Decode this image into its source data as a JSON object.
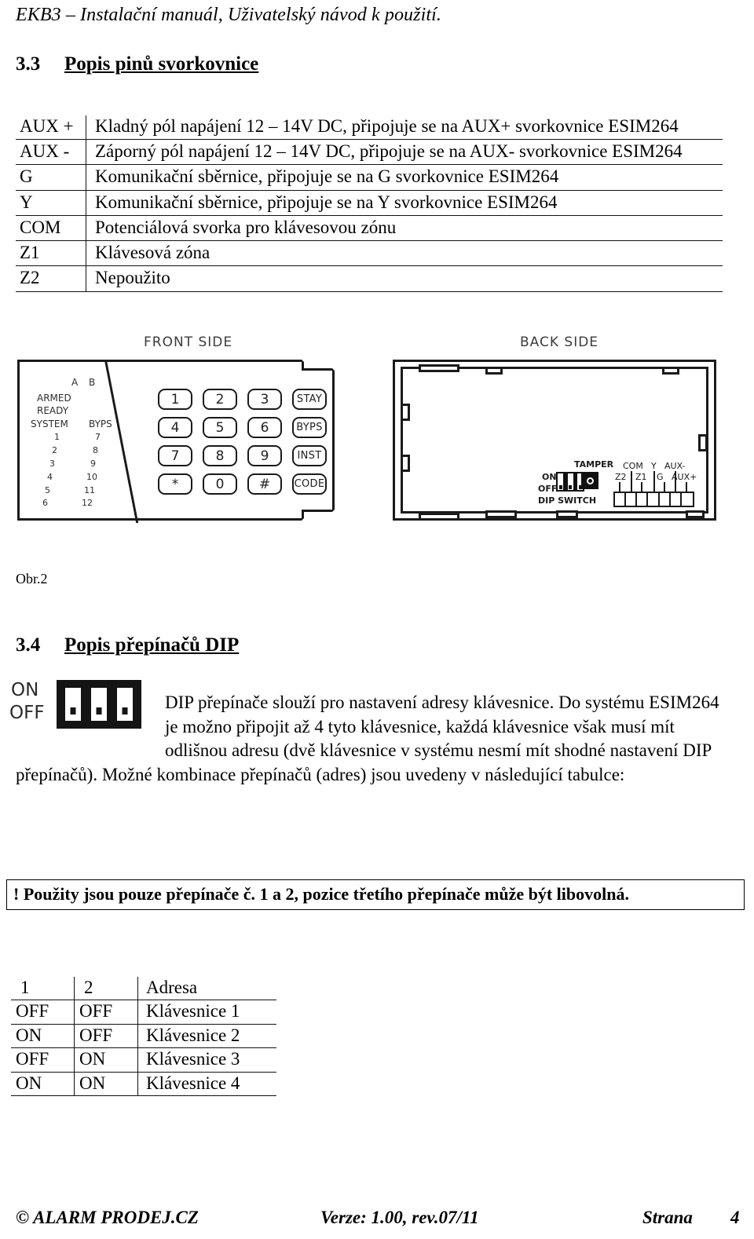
{
  "header": {
    "running_title": "EKB3 – Instalační manuál, Uživatelský návod k použití."
  },
  "sections": [
    {
      "number": "3.3",
      "title": "Popis pinů svorkovnice"
    },
    {
      "number": "3.4",
      "title": "Popis přepínačů DIP"
    }
  ],
  "pin_table": {
    "rows": [
      {
        "pin": "AUX +",
        "desc": "Kladný pól napájení 12 – 14V DC, připojuje se na AUX+ svorkovnice ESIM264"
      },
      {
        "pin": "AUX -",
        "desc": "Záporný pól napájení 12 – 14V DC, připojuje se na AUX- svorkovnice ESIM264"
      },
      {
        "pin": "G",
        "desc": "Komunikační sběrnice, připojuje se na G svorkovnice ESIM264"
      },
      {
        "pin": "Y",
        "desc": "Komunikační sběrnice, připojuje se na Y svorkovnice ESIM264"
      },
      {
        "pin": "COM",
        "desc": "Potenciálová svorka pro klávesovou zónu"
      },
      {
        "pin": "Z1",
        "desc": "Klávesová zóna"
      },
      {
        "pin": "Z2",
        "desc": "Nepoužito"
      }
    ]
  },
  "figure": {
    "caption": "Obr.2",
    "front": {
      "title": "FRONT SIDE",
      "col_headers": [
        "A",
        "B"
      ],
      "status_labels": [
        "ARMED",
        "READY",
        "SYSTEM"
      ],
      "zone_col_left": [
        "1",
        "2",
        "3",
        "4",
        "5",
        "6"
      ],
      "bypass_label": "BYPS",
      "zone_col_right": [
        "7",
        "8",
        "9",
        "10",
        "11",
        "12"
      ],
      "keys": [
        "1",
        "2",
        "3",
        "STAY",
        "4",
        "5",
        "6",
        "BYPS",
        "7",
        "8",
        "9",
        "INST",
        "*",
        "0",
        "#",
        "CODE"
      ]
    },
    "back": {
      "title": "BACK SIDE",
      "dip_on_label": "ON",
      "dip_off_label": "OFF",
      "dip_switch_label": "DIP SWITCH",
      "tamper_label": "TAMPER",
      "terminal_labels_top": [
        "COM",
        "Y",
        "AUX-"
      ],
      "terminal_labels_bottom": [
        "Z2",
        "Z1",
        "G",
        "AUX+"
      ],
      "terminal_order": [
        "Z2",
        "COM",
        "Z1",
        "Y",
        "G",
        "AUX-",
        "AUX+"
      ]
    }
  },
  "dip_section": {
    "graphic": {
      "on_label": "ON",
      "off_label": "OFF",
      "switch_count": 3
    },
    "paragraph": "DIP přepínače slouží pro nastavení adresy klávesnice. Do systému ESIM264 je možno připojit až 4 tyto klávesnice, každá klávesnice však musí mít odlišnou adresu (dvě klávesnice v systému nesmí mít shodné nastavení DIP přepínačů). Možné kombinace přepínačů (adres) jsou uvedeny v následující tabulce:",
    "warning": "! Použity jsou pouze přepínače č. 1 a 2, pozice třetího přepínače může být libovolná.",
    "address_table": {
      "headers": [
        "1",
        "2",
        "Adresa"
      ],
      "rows": [
        [
          "OFF",
          "OFF",
          "Klávesnice 1"
        ],
        [
          "ON",
          "OFF",
          "Klávesnice 2"
        ],
        [
          "OFF",
          "ON",
          "Klávesnice 3"
        ],
        [
          "ON",
          "ON",
          "Klávesnice 4"
        ]
      ]
    }
  },
  "footer": {
    "copyright": "© ALARM PRODEJ.CZ",
    "version": "Verze: 1.00, rev.07/11",
    "page_label": "Strana",
    "page_number": "4"
  }
}
